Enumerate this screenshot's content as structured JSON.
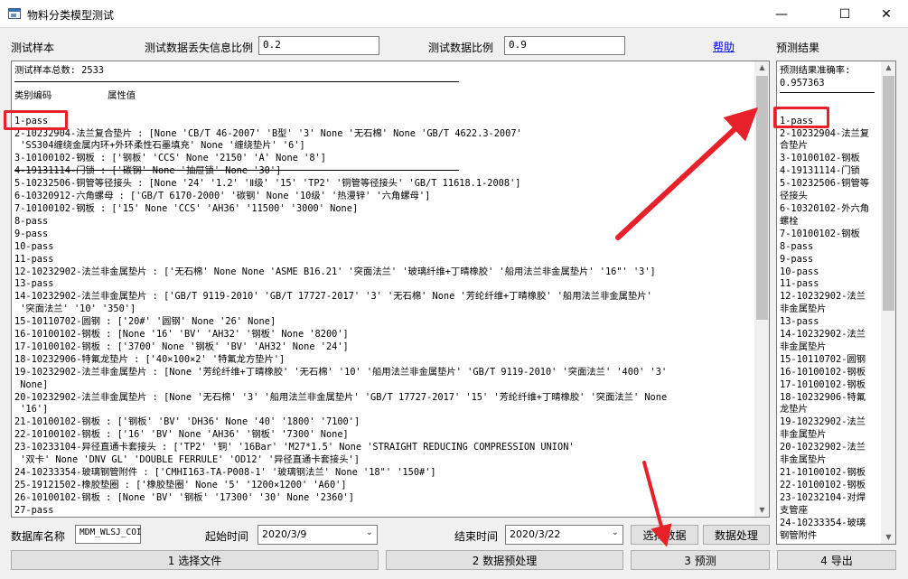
{
  "window": {
    "title": "物料分类模型测试",
    "minimize": "—",
    "maximize": "☐",
    "close": "✕"
  },
  "top": {
    "sample_label": "测试样本",
    "loss_label": "测试数据丢失信息比例",
    "loss_value": "0.2",
    "ratio_label": "测试数据比例",
    "ratio_value": "0.9",
    "help_link": "帮助",
    "result_label": "预测结果"
  },
  "main_text": {
    "lines": [
      "测试样本总数: 2533",
      "",
      "类别编码          属性值",
      "",
      "1-pass",
      "2-10232904-法兰复合垫片 : [None 'CB/T 46-2007' 'B型' '3' None '无石棉' None 'GB/T 4622.3-2007'",
      " 'SS304缠绕金属内环+外环柔性石墨填充' None '缠绕垫片' '6']",
      "3-10100102-钢板 : ['钢板' 'CCS' None '2150' 'A' None '8']",
      "4-19131114-门锁 : ['碳钢' None '抽屉锁' None '30']",
      "5-10232506-铜管等径接头 : [None '24' '1.2' 'Ⅱ级' '15' 'TP2' '铜管等径接头' 'GB/T 11618.1-2008']",
      "6-10320912-六角螺母 : ['GB/T 6170-2000' '碳钢' None '10级' '热漫锌' '六角螺母']",
      "7-10100102-钢板 : ['15' None 'CCS' 'AH36' '11500' '3000' None]",
      "8-pass",
      "9-pass",
      "10-pass",
      "11-pass",
      "12-10232902-法兰非金属垫片 : ['无石棉' None None 'ASME B16.21' '突面法兰' '玻璃纤维+丁晴橡胶' '船用法兰非金属垫片' '16\"' '3']",
      "13-pass",
      "14-10232902-法兰非金属垫片 : ['GB/T 9119-2010' 'GB/T 17727-2017' '3' '无石棉' None '芳纶纤维+丁晴橡胶' '船用法兰非金属垫片'",
      " '突面法兰' '10' '350']",
      "15-10110702-圆钢 : ['20#' '圆钢' None '26' None]",
      "16-10100102-钢板 : [None '16' 'BV' 'AH32' '钢板' None '8200']",
      "17-10100102-钢板 : ['3700' None '钢板' 'BV' 'AH32' None '24']",
      "18-10232906-特氟龙垫片 : ['40×100×2' '特氟龙方垫片']",
      "19-10232902-法兰非金属垫片 : [None '芳纶纤维+丁晴橡胶' '无石棉' '10' '船用法兰非金属垫片' 'GB/T 9119-2010' '突面法兰' '400' '3'",
      " None]",
      "20-10232902-法兰非金属垫片 : [None '无石棉' '3' '船用法兰非金属垫片' 'GB/T 17727-2017' '15' '芳纶纤维+丁晴橡胶' '突面法兰' None",
      " '16']",
      "21-10100102-钢板 : ['钢板' 'BV' 'DH36' None '40' '1800' '7100']",
      "22-10100102-钢板 : ['16' 'BV' None 'AH36' '钢板' '7300' None]",
      "23-10233104-异径直通卡套接头 : ['TP2' '铜' '16Bar' 'M27*1.5' None 'STRAIGHT REDUCING COMPRESSION UNION'",
      " '双卡' None 'DNV GL' 'DOUBLE FERRULE' 'OD12' '异径直通卡套接头']",
      "24-10233354-玻璃钢管附件 : ['CMHI163-TA-P008-1' '玻璃钢法兰' None '18\"' '150#']",
      "25-19121502-橡胶垫圈 : ['橡胶垫圈' None '5' '1200×1200' 'A60']",
      "26-10100102-钢板 : [None 'BV' '钢板' '17300' '30' None '2360']",
      "27-pass"
    ]
  },
  "result_text": {
    "lines": [
      "预测结果准确率:",
      "0.957363",
      "",
      "——",
      "1-pass",
      "2-10232904-法兰复",
      "合垫片",
      "3-10100102-钢板",
      "4-19131114-门锁",
      "5-10232506-铜管等",
      "径接头",
      "6-10320102-外六角",
      "螺栓",
      "7-10100102-钢板",
      "8-pass",
      "9-pass",
      "10-pass",
      "11-pass",
      "12-10232902-法兰",
      "非金属垫片",
      "13-pass",
      "14-10232902-法兰",
      "非金属垫片",
      "15-10110702-圆钢",
      "16-10100102-钢板",
      "17-10100102-钢板",
      "18-10232906-特氟",
      "龙垫片",
      "19-10232902-法兰",
      "非金属垫片",
      "20-10232902-法兰",
      "非金属垫片",
      "21-10100102-钢板",
      "22-10100102-钢板",
      "23-10232104-对焊",
      "支管座",
      "24-10233354-玻璃",
      "钢管附件"
    ]
  },
  "bottom": {
    "db_label": "数据库名称",
    "db_value": "MDM_WLSJ_COI",
    "start_label": "起始时间",
    "start_value": "2020/3/9",
    "end_label": "结束时间",
    "end_value": "2020/3/22",
    "select_data": "选择数据",
    "process_data": "数据处理",
    "btn1": "1 选择文件",
    "btn2": "2 数据预处理",
    "btn3": "3 预测",
    "btn4": "4 导出"
  },
  "colors": {
    "annotation": "#e8202a"
  }
}
